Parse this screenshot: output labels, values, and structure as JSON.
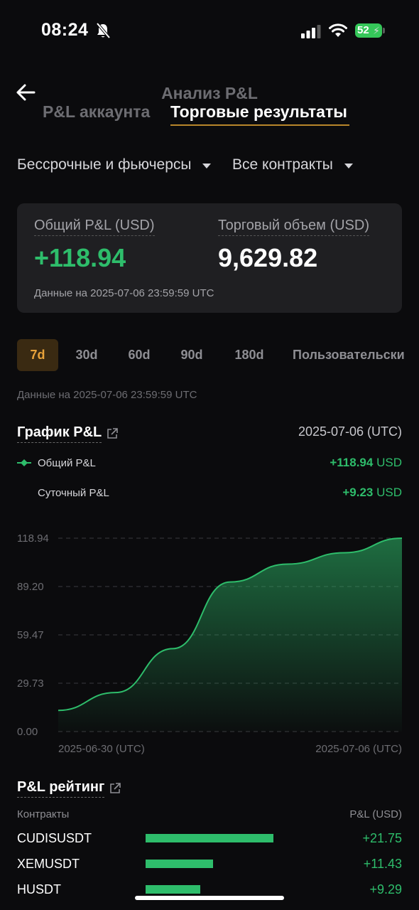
{
  "status_bar": {
    "time": "08:24",
    "battery": "52"
  },
  "header": {
    "title": "Анализ P&L",
    "tabs": [
      {
        "label": "P&L аккаунта",
        "active": false
      },
      {
        "label": "Торговые результаты",
        "active": true
      }
    ]
  },
  "filters": {
    "market": "Бессрочные и фьючерсы",
    "contracts": "Все контракты"
  },
  "summary": {
    "total_pl_label": "Общий P&L (USD)",
    "total_pl_value": "+118.94",
    "volume_label": "Торговый объем (USD)",
    "volume_value": "9,629.82",
    "data_note": "Данные на 2025-07-06 23:59:59 UTC"
  },
  "periods": {
    "items": [
      "7d",
      "30d",
      "60d",
      "90d",
      "180d",
      "Пользовательски"
    ],
    "selected": "7d",
    "data_note": "Данные на 2025-07-06 23:59:59 UTC"
  },
  "pl_chart_section": {
    "title": "График P&L",
    "date": "2025-07-06 (UTC)",
    "legend": [
      {
        "label": "Общий P&L",
        "value": "+118.94",
        "unit": "USD"
      },
      {
        "label": "Суточный P&L",
        "value": "+9.23",
        "unit": "USD"
      }
    ]
  },
  "chart_data": {
    "type": "area",
    "x": [
      "2025-06-30",
      "2025-07-01",
      "2025-07-02",
      "2025-07-03",
      "2025-07-04",
      "2025-07-05",
      "2025-07-06"
    ],
    "series": [
      {
        "name": "Общий P&L",
        "values": [
          13,
          24,
          51,
          92,
          103,
          110,
          118.94
        ]
      }
    ],
    "y_ticks": [
      "118.94",
      "89.20",
      "59.47",
      "29.73",
      "0.00"
    ],
    "x_tick_labels": [
      "2025-06-30 (UTC)",
      "2025-07-06 (UTC)"
    ],
    "ylim": [
      0,
      118.94
    ],
    "grid": true,
    "line_color": "#2ebd6b"
  },
  "ranking": {
    "title": "P&L рейтинг",
    "col_contract": "Контракты",
    "col_pl": "P&L (USD)",
    "rows": [
      {
        "contract": "CUDISUSDT",
        "value": "+21.75",
        "amount": 21.75
      },
      {
        "contract": "XEMUSDT",
        "value": "+11.43",
        "amount": 11.43
      },
      {
        "contract": "HUSDT",
        "value": "+9.29",
        "amount": 9.29
      }
    ]
  },
  "colors": {
    "accent": "#e8a23a",
    "positive": "#2ebd6b",
    "background": "#0b0b0d",
    "card": "#1f1f22"
  }
}
